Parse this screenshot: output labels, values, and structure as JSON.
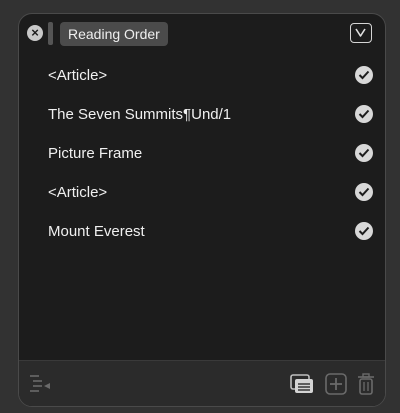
{
  "panel": {
    "title": "Reading Order"
  },
  "items": [
    {
      "label": "<Article>",
      "checked": true
    },
    {
      "label": "The Seven Summits¶Und/1",
      "checked": true
    },
    {
      "label": "Picture Frame",
      "checked": true
    },
    {
      "label": "<Article>",
      "checked": true
    },
    {
      "label": "Mount Everest",
      "checked": true
    }
  ],
  "icons": {
    "close": "close-icon",
    "collapse": "chevron-down-icon",
    "check": "checkmark-icon",
    "outline": "outline-icon",
    "stack": "stack-icon",
    "add": "add-icon",
    "delete": "trash-icon"
  },
  "colors": {
    "panel_bg": "#1c1c1c",
    "title_pill": "#4b4b4b",
    "check_bg": "#d8d8d8"
  }
}
